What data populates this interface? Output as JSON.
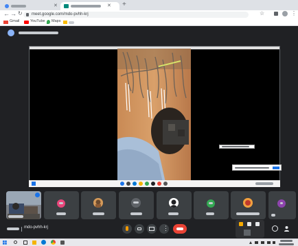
{
  "browser": {
    "tabs": [
      {
        "title": "",
        "active": false,
        "close": "✕"
      },
      {
        "title": "",
        "active": true,
        "close": "✕"
      }
    ],
    "new_tab": "+",
    "url": "meet.google.com/mdo-pvhh-krj",
    "bookmarks": [
      {
        "label": "Gmail",
        "icon": "gmail-icon"
      },
      {
        "label": "YouTube",
        "icon": "youtube-icon"
      },
      {
        "label": "Maps",
        "icon": "maps-icon"
      },
      {
        "label": "",
        "icon": "folder-icon"
      }
    ]
  },
  "meet": {
    "presenting_banner": "",
    "participants": [
      {
        "name": "",
        "color": "#7b7f86",
        "photo": true
      },
      {
        "name": "",
        "initial": "",
        "color": "#e8457a"
      },
      {
        "name": "",
        "initial": "",
        "color": "#b8763e",
        "photo": true
      },
      {
        "name": "",
        "initial": "",
        "color": "#5f6368"
      },
      {
        "name": "",
        "initial": "",
        "color": "#ffffff",
        "photo": true
      },
      {
        "name": "",
        "initial": "",
        "color": "#34a853"
      },
      {
        "name": "",
        "initial": "",
        "color": "#e8710a",
        "photo": true
      },
      {
        "name": "",
        "initial": "",
        "color": "#8e44ad"
      }
    ],
    "time": "",
    "meeting_code": "mdo-pvhh-krj"
  },
  "colors": {
    "meet_bg": "#202124",
    "tile_bg": "#3c4043",
    "end_call": "#ea4335",
    "accent_blue": "#1a73e8"
  }
}
